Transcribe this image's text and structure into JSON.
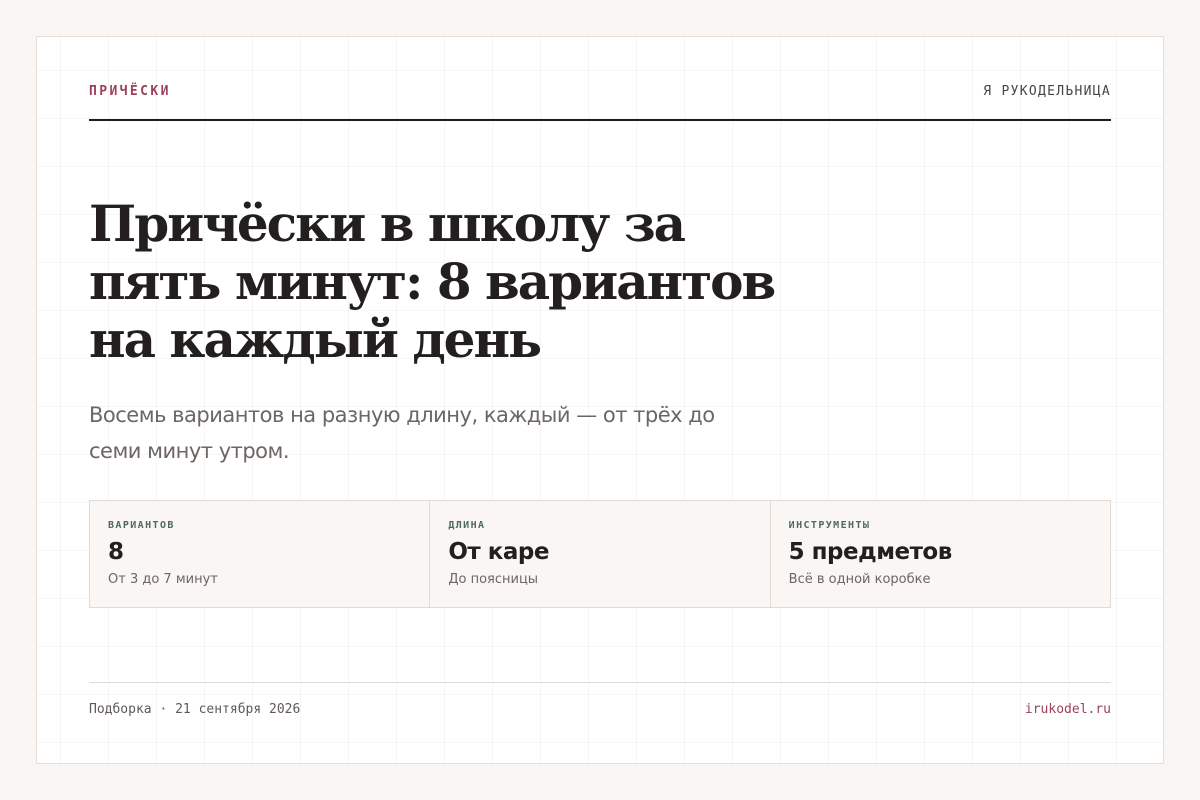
{
  "header": {
    "kicker": "ПРИЧЁСКИ",
    "brand": "Я РУКОДЕЛЬНИЦА"
  },
  "article": {
    "title": "Причёски в школу за пять минут: 8 вариантов на каждый день",
    "subtitle": "Восемь вариантов на разную длину, каждый — от трёх до семи минут утром."
  },
  "stats": [
    {
      "label": "ВАРИАНТОВ",
      "value": "8",
      "note": "От 3 до 7 минут"
    },
    {
      "label": "ДЛИНА",
      "value": "От каре",
      "note": "До поясницы"
    },
    {
      "label": "ИНСТРУМЕНТЫ",
      "value": "5 предметов",
      "note": "Всё в одной коробке"
    }
  ],
  "footer": {
    "meta": "Подборка · 21 сентября 2026",
    "site": "irukodel.ru"
  },
  "colors": {
    "accent": "#9c4258",
    "stat_label": "#4f6a5c",
    "text": "#221f1e",
    "muted": "#6d6663",
    "background": "#faf6f3"
  }
}
